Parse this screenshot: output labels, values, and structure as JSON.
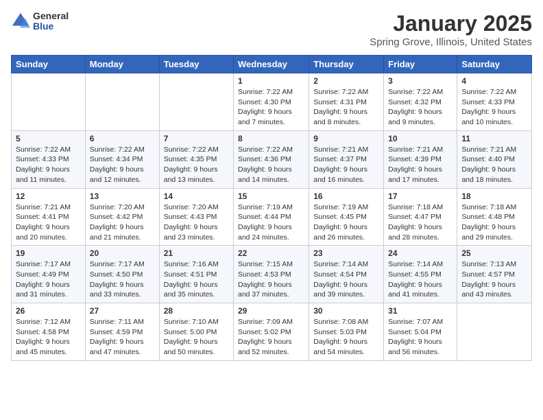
{
  "logo": {
    "general": "General",
    "blue": "Blue"
  },
  "header": {
    "month": "January 2025",
    "location": "Spring Grove, Illinois, United States"
  },
  "weekdays": [
    "Sunday",
    "Monday",
    "Tuesday",
    "Wednesday",
    "Thursday",
    "Friday",
    "Saturday"
  ],
  "weeks": [
    [
      {
        "day": "",
        "info": ""
      },
      {
        "day": "",
        "info": ""
      },
      {
        "day": "",
        "info": ""
      },
      {
        "day": "1",
        "info": "Sunrise: 7:22 AM\nSunset: 4:30 PM\nDaylight: 9 hours and 7 minutes."
      },
      {
        "day": "2",
        "info": "Sunrise: 7:22 AM\nSunset: 4:31 PM\nDaylight: 9 hours and 8 minutes."
      },
      {
        "day": "3",
        "info": "Sunrise: 7:22 AM\nSunset: 4:32 PM\nDaylight: 9 hours and 9 minutes."
      },
      {
        "day": "4",
        "info": "Sunrise: 7:22 AM\nSunset: 4:33 PM\nDaylight: 9 hours and 10 minutes."
      }
    ],
    [
      {
        "day": "5",
        "info": "Sunrise: 7:22 AM\nSunset: 4:33 PM\nDaylight: 9 hours and 11 minutes."
      },
      {
        "day": "6",
        "info": "Sunrise: 7:22 AM\nSunset: 4:34 PM\nDaylight: 9 hours and 12 minutes."
      },
      {
        "day": "7",
        "info": "Sunrise: 7:22 AM\nSunset: 4:35 PM\nDaylight: 9 hours and 13 minutes."
      },
      {
        "day": "8",
        "info": "Sunrise: 7:22 AM\nSunset: 4:36 PM\nDaylight: 9 hours and 14 minutes."
      },
      {
        "day": "9",
        "info": "Sunrise: 7:21 AM\nSunset: 4:37 PM\nDaylight: 9 hours and 16 minutes."
      },
      {
        "day": "10",
        "info": "Sunrise: 7:21 AM\nSunset: 4:39 PM\nDaylight: 9 hours and 17 minutes."
      },
      {
        "day": "11",
        "info": "Sunrise: 7:21 AM\nSunset: 4:40 PM\nDaylight: 9 hours and 18 minutes."
      }
    ],
    [
      {
        "day": "12",
        "info": "Sunrise: 7:21 AM\nSunset: 4:41 PM\nDaylight: 9 hours and 20 minutes."
      },
      {
        "day": "13",
        "info": "Sunrise: 7:20 AM\nSunset: 4:42 PM\nDaylight: 9 hours and 21 minutes."
      },
      {
        "day": "14",
        "info": "Sunrise: 7:20 AM\nSunset: 4:43 PM\nDaylight: 9 hours and 23 minutes."
      },
      {
        "day": "15",
        "info": "Sunrise: 7:19 AM\nSunset: 4:44 PM\nDaylight: 9 hours and 24 minutes."
      },
      {
        "day": "16",
        "info": "Sunrise: 7:19 AM\nSunset: 4:45 PM\nDaylight: 9 hours and 26 minutes."
      },
      {
        "day": "17",
        "info": "Sunrise: 7:18 AM\nSunset: 4:47 PM\nDaylight: 9 hours and 28 minutes."
      },
      {
        "day": "18",
        "info": "Sunrise: 7:18 AM\nSunset: 4:48 PM\nDaylight: 9 hours and 29 minutes."
      }
    ],
    [
      {
        "day": "19",
        "info": "Sunrise: 7:17 AM\nSunset: 4:49 PM\nDaylight: 9 hours and 31 minutes."
      },
      {
        "day": "20",
        "info": "Sunrise: 7:17 AM\nSunset: 4:50 PM\nDaylight: 9 hours and 33 minutes."
      },
      {
        "day": "21",
        "info": "Sunrise: 7:16 AM\nSunset: 4:51 PM\nDaylight: 9 hours and 35 minutes."
      },
      {
        "day": "22",
        "info": "Sunrise: 7:15 AM\nSunset: 4:53 PM\nDaylight: 9 hours and 37 minutes."
      },
      {
        "day": "23",
        "info": "Sunrise: 7:14 AM\nSunset: 4:54 PM\nDaylight: 9 hours and 39 minutes."
      },
      {
        "day": "24",
        "info": "Sunrise: 7:14 AM\nSunset: 4:55 PM\nDaylight: 9 hours and 41 minutes."
      },
      {
        "day": "25",
        "info": "Sunrise: 7:13 AM\nSunset: 4:57 PM\nDaylight: 9 hours and 43 minutes."
      }
    ],
    [
      {
        "day": "26",
        "info": "Sunrise: 7:12 AM\nSunset: 4:58 PM\nDaylight: 9 hours and 45 minutes."
      },
      {
        "day": "27",
        "info": "Sunrise: 7:11 AM\nSunset: 4:59 PM\nDaylight: 9 hours and 47 minutes."
      },
      {
        "day": "28",
        "info": "Sunrise: 7:10 AM\nSunset: 5:00 PM\nDaylight: 9 hours and 50 minutes."
      },
      {
        "day": "29",
        "info": "Sunrise: 7:09 AM\nSunset: 5:02 PM\nDaylight: 9 hours and 52 minutes."
      },
      {
        "day": "30",
        "info": "Sunrise: 7:08 AM\nSunset: 5:03 PM\nDaylight: 9 hours and 54 minutes."
      },
      {
        "day": "31",
        "info": "Sunrise: 7:07 AM\nSunset: 5:04 PM\nDaylight: 9 hours and 56 minutes."
      },
      {
        "day": "",
        "info": ""
      }
    ]
  ]
}
